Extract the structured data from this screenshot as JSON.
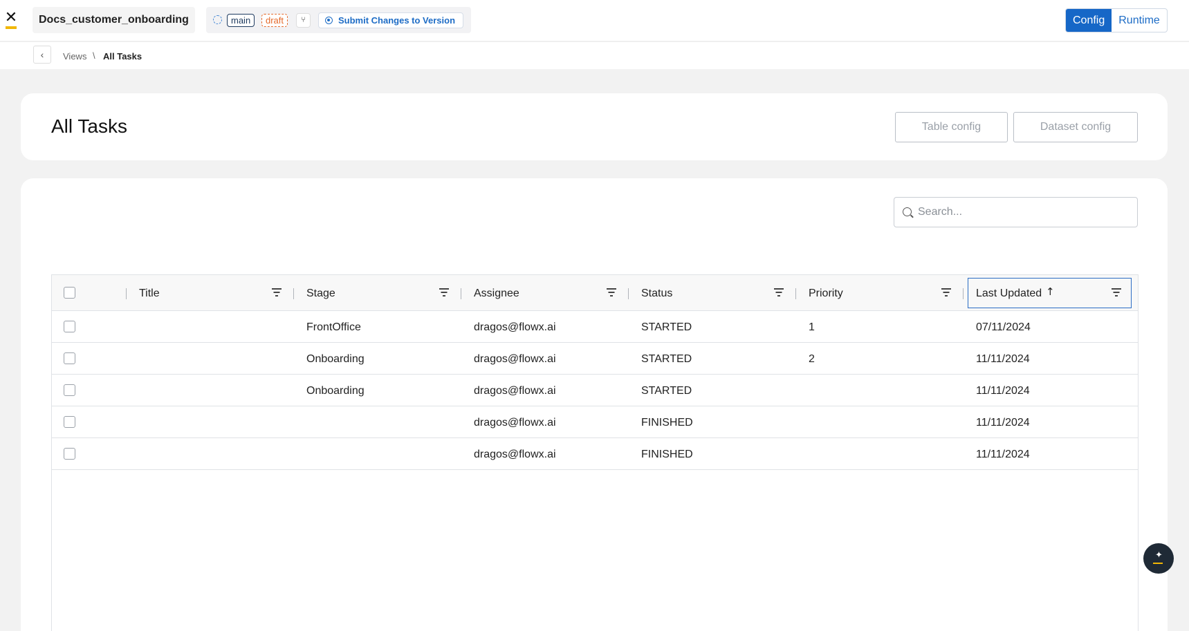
{
  "app": {
    "project_name": "Docs_customer_onboarding",
    "branch_chip": "main",
    "status_chip": "draft",
    "submit_label": "Submit Changes to Version",
    "modes": [
      "Config",
      "Runtime"
    ],
    "active_mode": "Config",
    "logo_icon": "flowx-logo-icon"
  },
  "breadcrumb": {
    "parent": "Views",
    "separator": "\\",
    "current": "All Tasks"
  },
  "page": {
    "title": "All Tasks",
    "table_config_label": "Table config",
    "dataset_config_label": "Dataset config"
  },
  "search": {
    "placeholder": "Search..."
  },
  "table": {
    "columns": [
      "Title",
      "Stage",
      "Assignee",
      "Status",
      "Priority",
      "Last Updated"
    ],
    "sorted_column": "Last Updated",
    "sort_direction": "ascending",
    "rows": [
      {
        "title": "",
        "stage": "FrontOffice",
        "assignee": "dragos@flowx.ai",
        "status": "STARTED",
        "priority": "1",
        "last_updated": "07/11/2024"
      },
      {
        "title": "",
        "stage": "Onboarding",
        "assignee": "dragos@flowx.ai",
        "status": "STARTED",
        "priority": "2",
        "last_updated": "11/11/2024"
      },
      {
        "title": "",
        "stage": "Onboarding",
        "assignee": "dragos@flowx.ai",
        "status": "STARTED",
        "priority": "",
        "last_updated": "11/11/2024"
      },
      {
        "title": "",
        "stage": "",
        "assignee": "dragos@flowx.ai",
        "status": "FINISHED",
        "priority": "",
        "last_updated": "11/11/2024"
      },
      {
        "title": "",
        "stage": "",
        "assignee": "dragos@flowx.ai",
        "status": "FINISHED",
        "priority": "",
        "last_updated": "11/11/2024"
      }
    ]
  },
  "colors": {
    "accent": "#1667c7",
    "draft": "#e56a2b",
    "brand_yellow": "#f2b705"
  }
}
